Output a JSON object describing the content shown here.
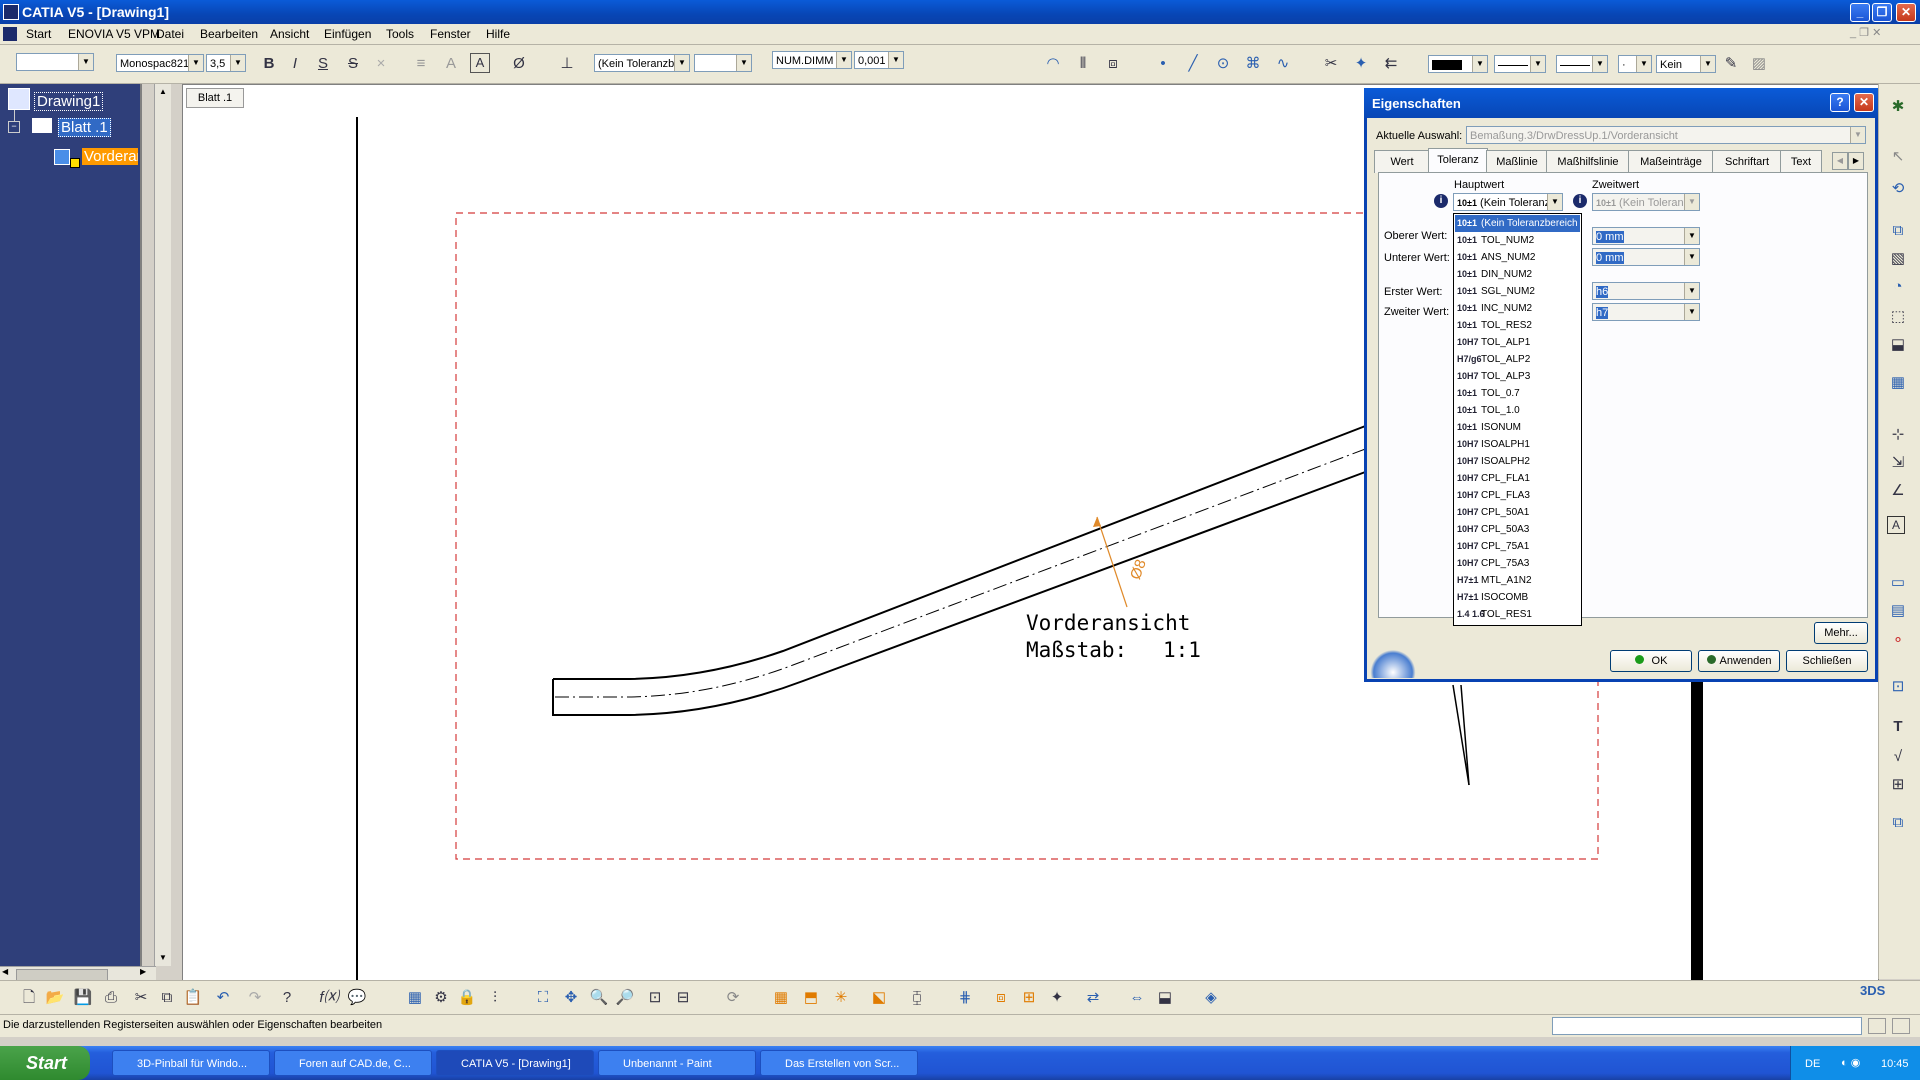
{
  "window": {
    "title": "CATIA V5 - [Drawing1]"
  },
  "menubar": {
    "items": [
      "Start",
      "ENOVIA V5 VPM",
      "Datei",
      "Bearbeiten",
      "Ansicht",
      "Einfügen",
      "Tools",
      "Fenster",
      "Hilfe"
    ]
  },
  "toolbar": {
    "font_name": "Monospac821",
    "font_size": "3,5",
    "tolerance_combo": "(Kein Toleranzb",
    "num_format": "NUM.DIMM",
    "precision": "0,001",
    "line_pattern": "Kein"
  },
  "tree": {
    "root": "Drawing1",
    "sheet": "Blatt .1",
    "view": "Vorderans"
  },
  "sheet_tab": "Blatt .1",
  "drawing": {
    "view_label": "Vorderansicht",
    "scale_label": "Maßstab:",
    "scale_value": "1:1",
    "dimension": "Ø8"
  },
  "dialog": {
    "title": "Eigenschaften",
    "current_selection_label": "Aktuelle Auswahl:",
    "current_selection_value": "Bemaßung.3/DrwDressUp.1/Vorderansicht",
    "tabs": [
      "Wert",
      "Toleranz",
      "Maßlinie",
      "Maßhilfslinie",
      "Maßeinträge",
      "Schriftart",
      "Text"
    ],
    "active_tab": "Toleranz",
    "main_value_label": "Hauptwert",
    "second_value_label": "Zweitwert",
    "main_value_combo": "(Kein Toleranz",
    "second_value_combo": "(Kein Toleran",
    "upper_label": "Oberer Wert:",
    "lower_label": "Unterer Wert:",
    "first_label": "Erster Wert:",
    "second_label": "Zweiter Wert:",
    "upper_value": "0 mm",
    "lower_value": "0 mm",
    "first_value": "h6",
    "second_value": "h7",
    "more_button": "Mehr...",
    "ok_button": "OK",
    "apply_button": "Anwenden",
    "close_button": "Schließen"
  },
  "tolerance_list": [
    {
      "icon": "10±1",
      "label": "(Kein Toleranzbereich"
    },
    {
      "icon": "10±1",
      "label": "TOL_NUM2"
    },
    {
      "icon": "10±1",
      "label": "ANS_NUM2"
    },
    {
      "icon": "10±1",
      "label": "DIN_NUM2"
    },
    {
      "icon": "10±1",
      "label": "SGL_NUM2"
    },
    {
      "icon": "10±1",
      "label": "INC_NUM2"
    },
    {
      "icon": "10±1",
      "label": "TOL_RES2"
    },
    {
      "icon": "10H7",
      "label": "TOL_ALP1"
    },
    {
      "icon": "H7/g6",
      "label": "TOL_ALP2"
    },
    {
      "icon": "10H7",
      "label": "TOL_ALP3"
    },
    {
      "icon": "10±1",
      "label": "TOL_0.7"
    },
    {
      "icon": "10±1",
      "label": "TOL_1.0"
    },
    {
      "icon": "10±1",
      "label": "ISONUM"
    },
    {
      "icon": "10H7",
      "label": "ISOALPH1"
    },
    {
      "icon": "10H7",
      "label": "ISOALPH2"
    },
    {
      "icon": "10H7",
      "label": "CPL_FLA1"
    },
    {
      "icon": "10H7",
      "label": "CPL_FLA3"
    },
    {
      "icon": "10H7",
      "label": "CPL_50A1"
    },
    {
      "icon": "10H7",
      "label": "CPL_50A3"
    },
    {
      "icon": "10H7",
      "label": "CPL_75A1"
    },
    {
      "icon": "10H7",
      "label": "CPL_75A3"
    },
    {
      "icon": "H7±1",
      "label": "MTL_A1N2"
    },
    {
      "icon": "H7±1",
      "label": "ISOCOMB"
    },
    {
      "icon": "1.4 1.6",
      "label": "TOL_RES1"
    }
  ],
  "status": {
    "text": "Die darzustellenden Registerseiten auswählen oder Eigenschaften bearbeiten"
  },
  "taskbar": {
    "start": "Start",
    "items": [
      "3D-Pinball für Windo...",
      "Foren auf CAD.de, C...",
      "CATIA V5 - [Drawing1]",
      "Unbenannt - Paint",
      "Das Erstellen von Scr..."
    ],
    "lang": "DE",
    "clock": "10:45"
  }
}
